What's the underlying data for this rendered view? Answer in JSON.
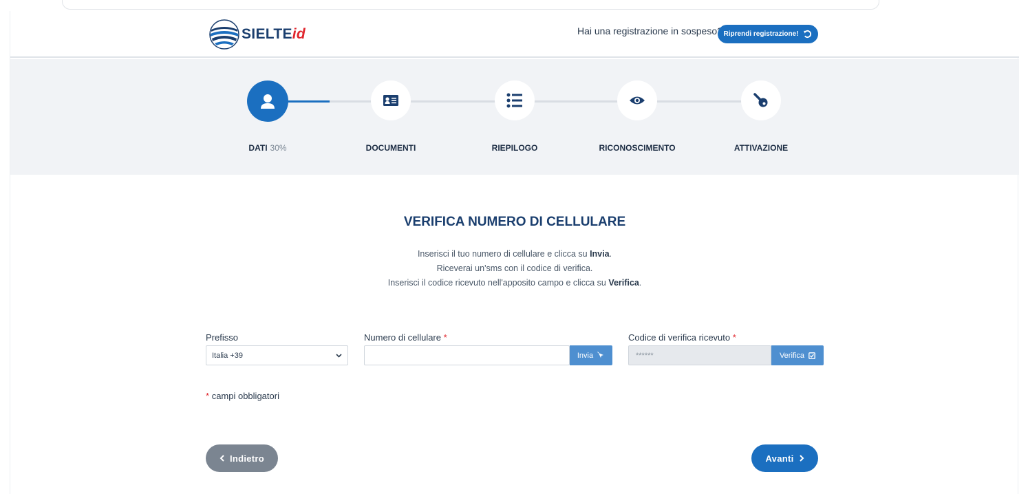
{
  "header": {
    "brand_main": "SIELTE",
    "brand_suffix": "id",
    "pending_text": "Hai una registrazione in sospeso?",
    "resume_label": "Riprendi registrazione!"
  },
  "stepper": {
    "progress_percent": 30,
    "steps": [
      {
        "label": "DATI",
        "extra": "30%",
        "icon": "user-icon",
        "active": true
      },
      {
        "label": "DOCUMENTI",
        "extra": "",
        "icon": "id-card-icon",
        "active": false
      },
      {
        "label": "RIEPILOGO",
        "extra": "",
        "icon": "list-icon",
        "active": false
      },
      {
        "label": "RICONOSCIMENTO",
        "extra": "",
        "icon": "eye-icon",
        "active": false
      },
      {
        "label": "ATTIVAZIONE",
        "extra": "",
        "icon": "key-icon",
        "active": false
      }
    ]
  },
  "form": {
    "title": "VERIFICA NUMERO DI CELLULARE",
    "instructions": {
      "line1_pre": "Inserisci il tuo numero di cellulare e clicca su ",
      "line1_bold": "Invia",
      "line1_post": ".",
      "line2": "Riceverai un'sms con il codice di verifica.",
      "line3_pre": "Inserisci il codice ricevuto nell'apposito campo e clicca su ",
      "line3_bold": "Verifica",
      "line3_post": "."
    },
    "prefix_label": "Prefisso",
    "prefix_value": "Italia +39",
    "phone_label": "Numero di cellulare",
    "phone_value": "",
    "send_label": "Invia",
    "code_label": "Codice di verifica ricevuto",
    "code_placeholder": "******",
    "verify_label": "Verifica",
    "required_mark": "*",
    "mandatory_note": "campi obbligatori"
  },
  "nav": {
    "back_label": "Indietro",
    "next_label": "Avanti"
  },
  "colors": {
    "primary": "#1b6fc0",
    "addon": "#4e8fd0",
    "back_button": "#7b8591",
    "required": "#e0262d",
    "stepper_bg": "#f1f3f6"
  }
}
